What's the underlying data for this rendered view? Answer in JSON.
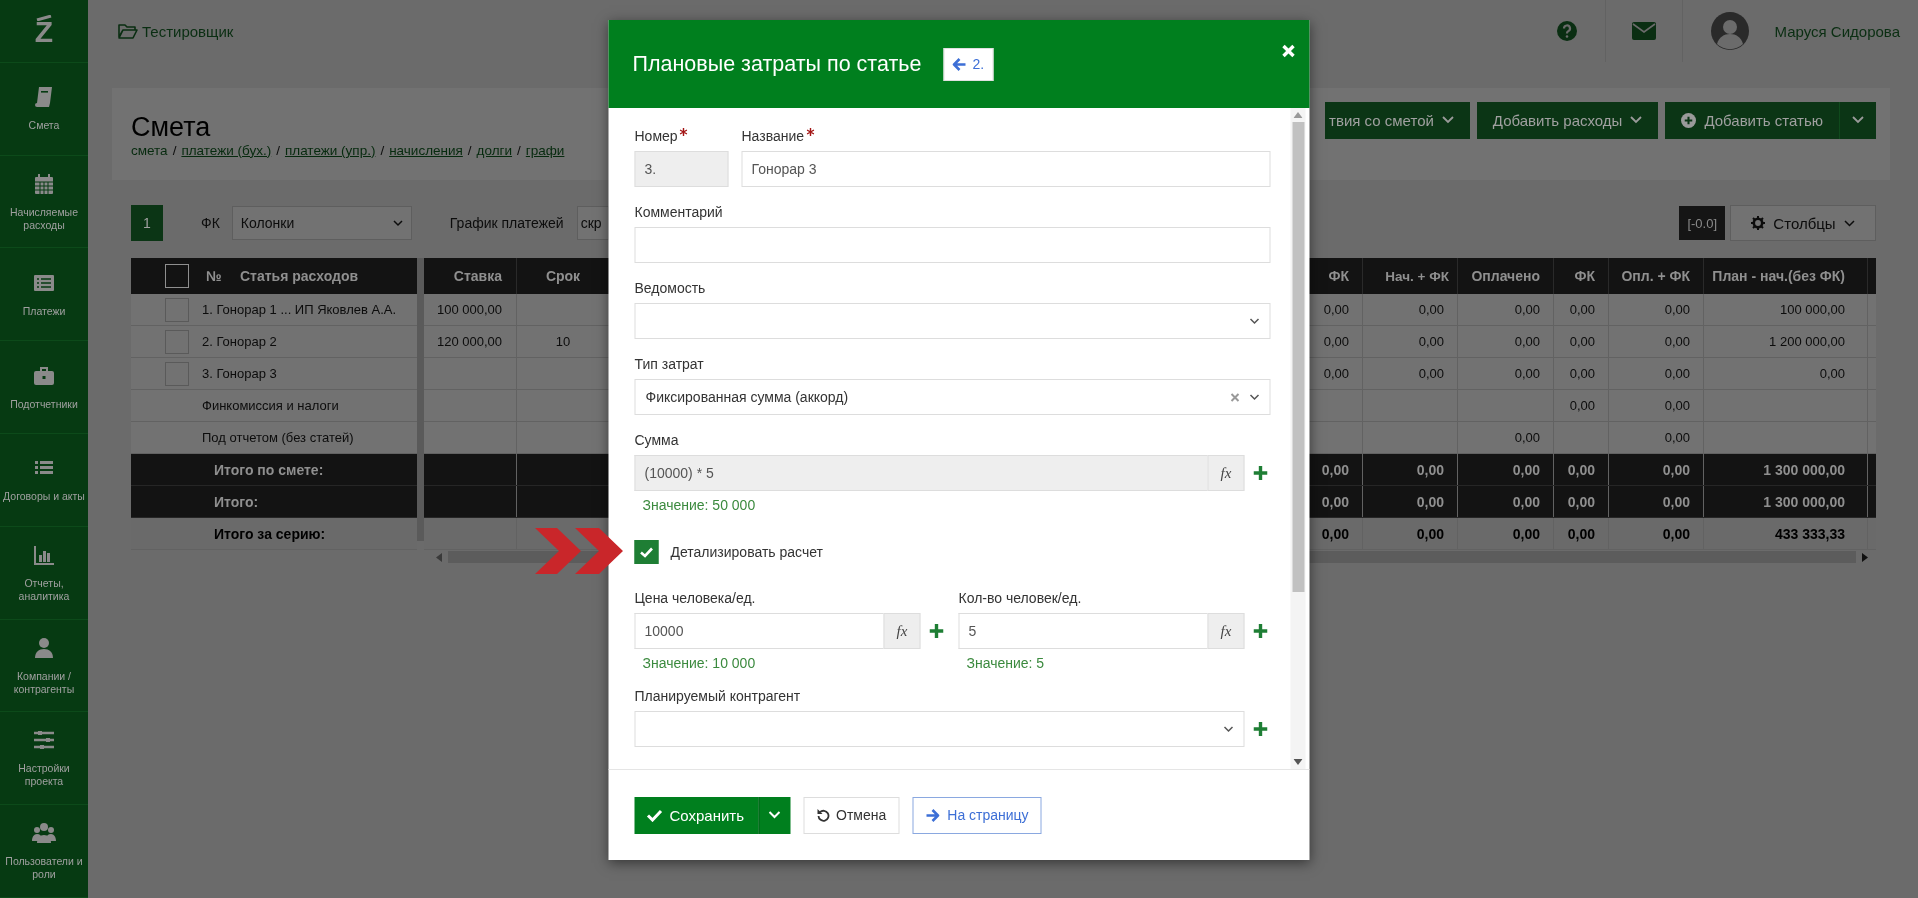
{
  "logo": "Z",
  "sidebar": {
    "items": [
      {
        "label": "Смета"
      },
      {
        "label": "Начисляемые расходы"
      },
      {
        "label": "Платежи"
      },
      {
        "label": "Подотчетники"
      },
      {
        "label": "Договоры и акты"
      },
      {
        "label": "Отчеты, аналитика"
      },
      {
        "label": "Компании / контрагенты"
      },
      {
        "label": "Настройки проекта"
      },
      {
        "label": "Пользователи и роли"
      }
    ]
  },
  "topbar": {
    "project": "Тестировщик",
    "user": "Маруся Сидорова"
  },
  "page": {
    "title": "Смета",
    "breadcrumbs": [
      {
        "label": "смета",
        "kind": "current"
      },
      {
        "label": "/",
        "kind": "separator"
      },
      {
        "label": "платежи (бух.)",
        "kind": "link"
      },
      {
        "label": "/",
        "kind": "separator"
      },
      {
        "label": "платежи (упр.)",
        "kind": "link"
      },
      {
        "label": "/",
        "kind": "separator"
      },
      {
        "label": "начисления",
        "kind": "link"
      },
      {
        "label": "/",
        "kind": "separator"
      },
      {
        "label": "долги",
        "kind": "link"
      },
      {
        "label": "/",
        "kind": "separator"
      },
      {
        "label": "графи",
        "kind": "link"
      }
    ],
    "actions": [
      {
        "label": "твия со сметой",
        "kind": "dropdown"
      },
      {
        "label": "Добавить расходы",
        "kind": "dropdown"
      },
      {
        "label": "Добавить статью",
        "kind": "split"
      }
    ]
  },
  "toolbar": {
    "page_badge": "1",
    "fk_label": "ФК",
    "columns_select": "Колонки",
    "schedule_label": "График платежей",
    "schedule_select": "скр",
    "rounding": "[-0.0]",
    "columns_button": "Столбцы"
  },
  "table": {
    "select_all_checked": false,
    "left_columns": [
      "№",
      "Статья расходов"
    ],
    "right_columns": [
      "Ставка",
      "Срок",
      "ФК",
      "Нач. + ФК",
      "Оплачено",
      "ФК",
      "Опл. + ФК",
      "План - нач.(без ФК)"
    ],
    "rows": [
      {
        "kind": "item",
        "checked": false,
        "name": "1. Гонорар 1 ... ИП Яковлев А.А.",
        "rate": "100 000,00",
        "values": {
          "fk": "0,00",
          "accrued_plus_fk": "0,00",
          "paid": "0,00",
          "fk_2": "0,00",
          "paid_plus_fk": "0,00",
          "plan_minus_accrued": "100 000,00"
        }
      },
      {
        "kind": "item",
        "checked": false,
        "name": "2. Гонорар 2",
        "rate": "120 000,00",
        "term": "10",
        "values": {
          "fk": "0,00",
          "accrued_plus_fk": "0,00",
          "paid": "0,00",
          "fk_2": "0,00",
          "paid_plus_fk": "0,00",
          "plan_minus_accrued": "1 200 000,00"
        }
      },
      {
        "kind": "item",
        "checked": false,
        "name": "3. Гонорар 3",
        "values": {
          "fk": "0,00",
          "accrued_plus_fk": "0,00",
          "paid": "0,00",
          "fk_2": "0,00",
          "paid_plus_fk": "0,00",
          "plan_minus_accrued": "0,00"
        }
      },
      {
        "kind": "plain",
        "name": "Финкомиссия и налоги",
        "values": {
          "fk_2": "0,00",
          "paid_plus_fk": "0,00"
        }
      },
      {
        "kind": "plain",
        "name": "Под отчетом (без статей)",
        "values": {
          "paid": "0,00",
          "paid_plus_fk": "0,00"
        }
      },
      {
        "kind": "total",
        "name": "Итого по смете:",
        "values": {
          "fk": "0,00",
          "accrued_plus_fk": "0,00",
          "paid": "0,00",
          "fk_2": "0,00",
          "paid_plus_fk": "0,00",
          "plan_minus_accrued": "1 300 000,00"
        }
      },
      {
        "kind": "total",
        "name": "Итого:",
        "values": {
          "fk": "0,00",
          "accrued_plus_fk": "0,00",
          "paid": "0,00",
          "fk_2": "0,00",
          "paid_plus_fk": "0,00",
          "plan_minus_accrued": "1 300 000,00"
        }
      },
      {
        "kind": "series",
        "name": "Итого за серию:",
        "values": {
          "fk": "0,00",
          "accrued_plus_fk": "0,00",
          "paid": "0,00",
          "fk_2": "0,00",
          "paid_plus_fk": "0,00",
          "plan_minus_accrued": "433 333,33"
        }
      }
    ]
  },
  "modal": {
    "title": "Плановые затраты по статье",
    "back_button": "2.",
    "number": {
      "label": "Номер",
      "required": true,
      "readonly": true,
      "value": "3."
    },
    "name": {
      "label": "Название",
      "required": true,
      "readonly": false,
      "value": "Гонорар 3"
    },
    "comment": {
      "label": "Комментарий"
    },
    "statement": {
      "label": "Ведомость"
    },
    "cost_type": {
      "label": "Тип затрат",
      "value": "Фиксированная сумма (аккорд)"
    },
    "sum": {
      "label": "Сумма",
      "readonly": true,
      "value": "(10000) * 5",
      "addon": "fx",
      "result": "Значение: 50 000"
    },
    "detail": {
      "label": "Детализировать расчет",
      "checked": true
    },
    "price": {
      "label": "Цена человека/ед.",
      "readonly": false,
      "value": "10000",
      "addon": "fx",
      "result": "Значение: 10 000"
    },
    "quantity": {
      "label": "Кол-во человек/ед.",
      "readonly": false,
      "value": "5",
      "addon": "fx",
      "result": "Значение: 5"
    },
    "counterparty": {
      "label": "Планируемый контрагент"
    },
    "buttons": {
      "save": "Сохранить",
      "cancel": "Отмена",
      "page": "На страницу"
    }
  }
}
